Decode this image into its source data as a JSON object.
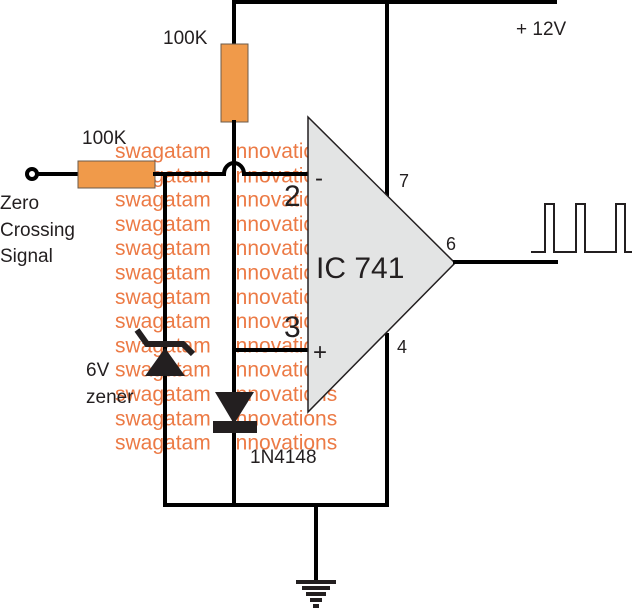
{
  "diagram": {
    "type": "op-amp zero crossing comparator schematic",
    "supply_label": "+ 12V",
    "ic": {
      "label": "IC 741",
      "pin_inverting": "2",
      "pin_noninverting": "3",
      "pin_vcc": "7",
      "pin_gnd": "4",
      "pin_output": "6",
      "inverting_symbol": "-",
      "noninverting_symbol": "+"
    },
    "resistor_top_label": "100K",
    "resistor_input_label": "100K",
    "input_label_line1": "Zero",
    "input_label_line2": "Crossing",
    "input_label_line3": "Signal",
    "zener_label_line1": "6V",
    "zener_label_line2": "zener",
    "diode_label": "1N4148",
    "output_waveform": "square-pulse-train",
    "colors": {
      "wire": "#000000",
      "resistor_fill": "#f09a4a",
      "opamp_fill": "#e3e4e4",
      "watermark": "#ec7a45",
      "text": "#231f20"
    },
    "watermark": {
      "text_left": "swagatam",
      "text_right": "innovations",
      "rows": 13
    }
  }
}
